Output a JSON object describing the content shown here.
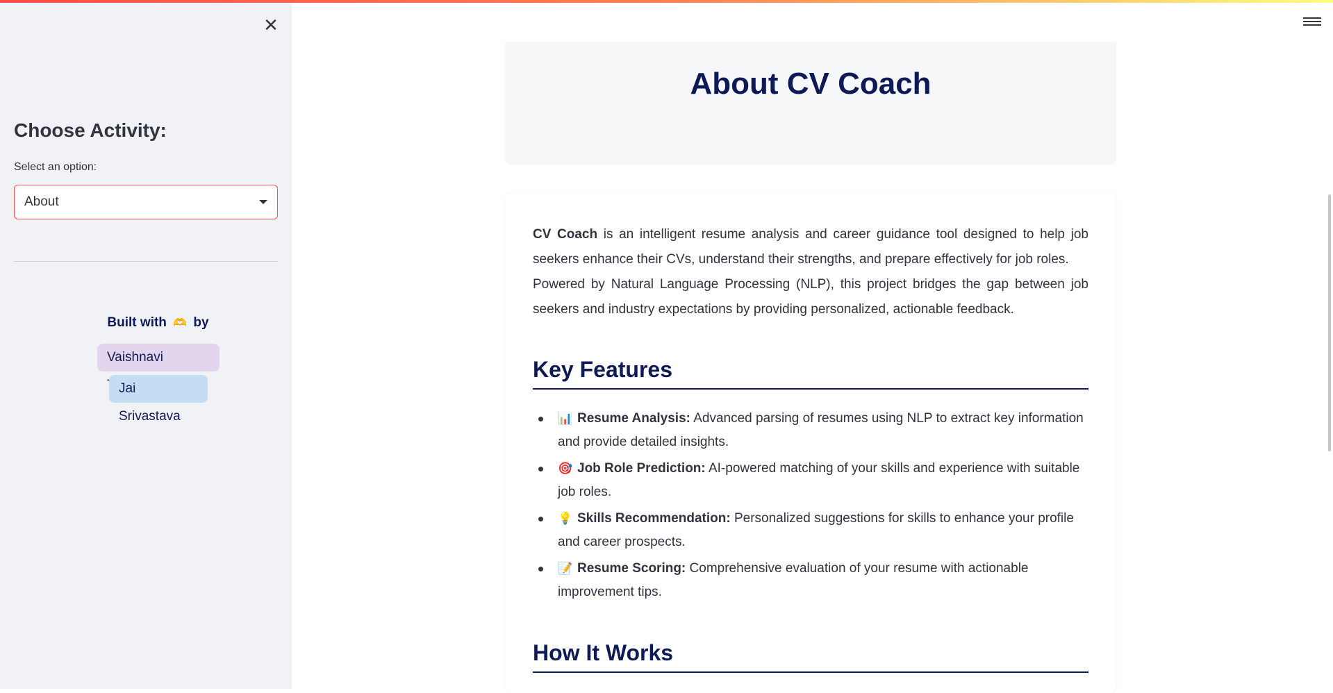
{
  "sidebar": {
    "close_glyph": "✕",
    "heading": "Choose Activity:",
    "select_label": "Select an option:",
    "select_value": "About",
    "built_prefix": "Built with",
    "built_heart": "🫶",
    "built_suffix": "by",
    "authors": [
      "Vaishnavi Tripathi",
      "Jai Srivastava"
    ]
  },
  "hero": {
    "title": "About CV Coach"
  },
  "intro": {
    "brand": "CV Coach",
    "line1": " is an intelligent resume analysis and career guidance tool designed to help job seekers enhance their CVs, understand their strengths, and prepare effectively for job roles.",
    "line2": "Powered by Natural Language Processing (NLP), this project bridges the gap between job seekers and industry expectations by providing personalized, actionable feedback."
  },
  "sections": {
    "key_features": "Key Features",
    "how_it_works": "How It Works"
  },
  "features": [
    {
      "icon": "📊",
      "title": "Resume Analysis:",
      "text": " Advanced parsing of resumes using NLP to extract key information and provide detailed insights."
    },
    {
      "icon": "🎯",
      "title": "Job Role Prediction:",
      "text": " AI-powered matching of your skills and experience with suitable job roles."
    },
    {
      "icon": "💡",
      "title": "Skills Recommendation:",
      "text": " Personalized suggestions for skills to enhance your profile and career prospects."
    },
    {
      "icon": "📝",
      "title": "Resume Scoring:",
      "text": " Comprehensive evaluation of your resume with actionable improvement tips."
    }
  ],
  "colors": {
    "accent": "#ff4b4b",
    "heading": "#0e1a55",
    "sidebar_bg": "#f0f2f6"
  }
}
